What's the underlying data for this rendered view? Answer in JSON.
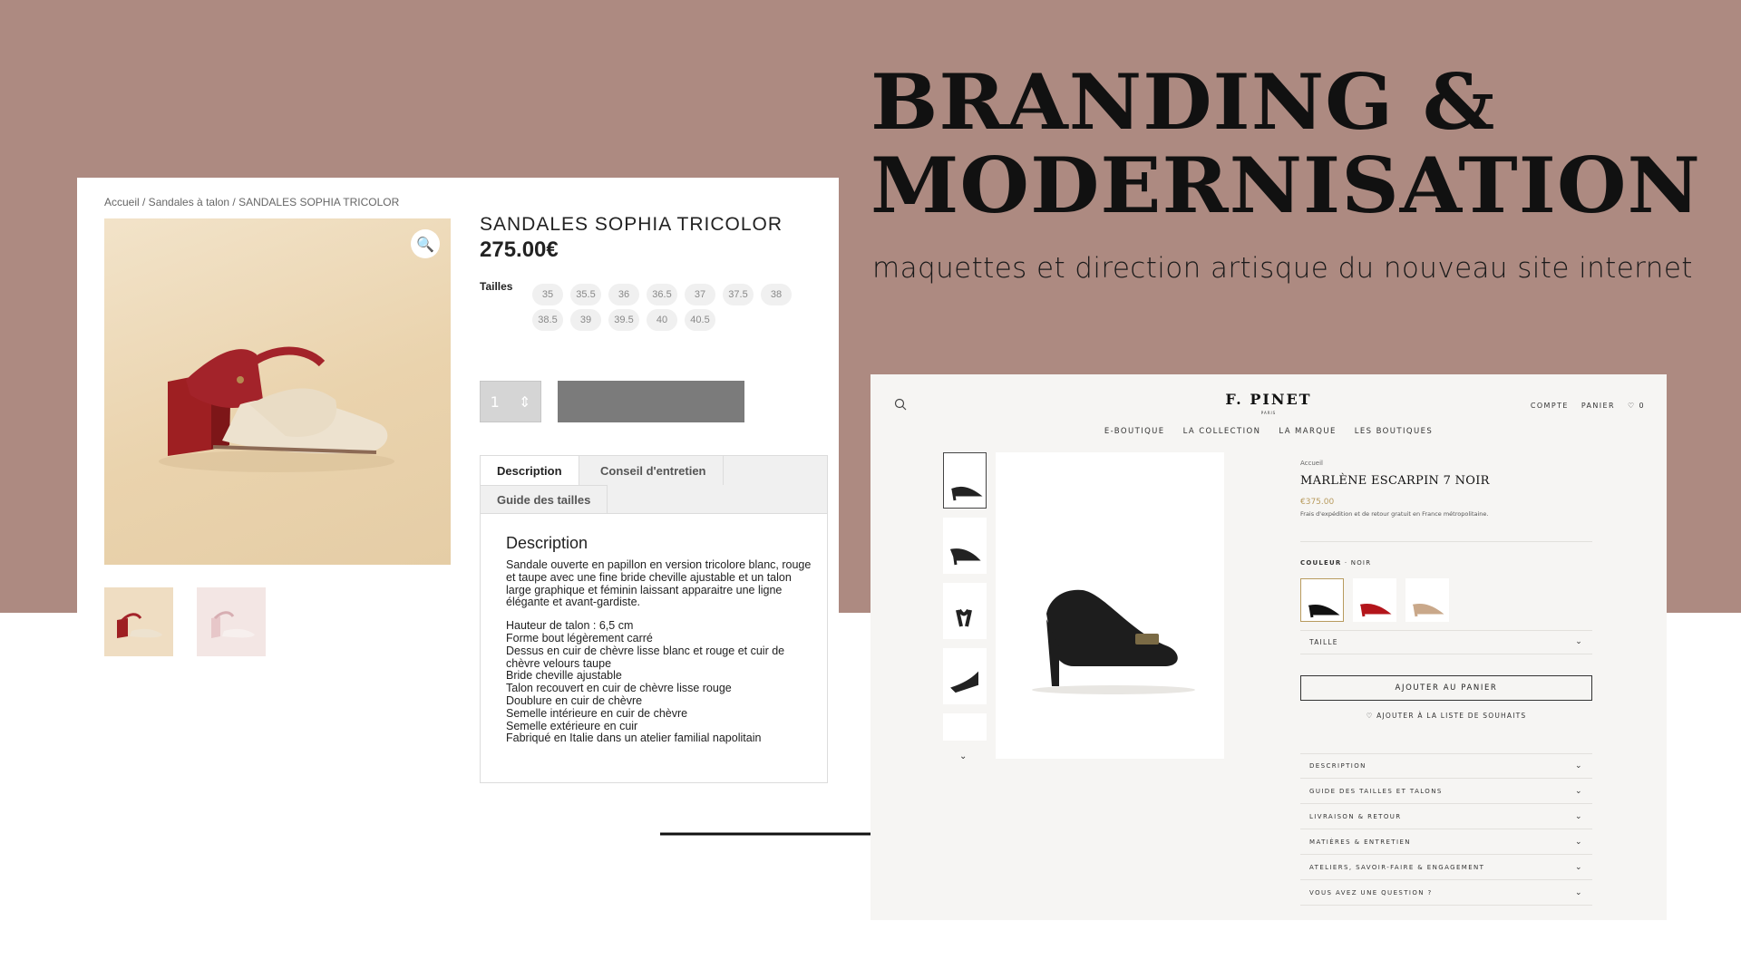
{
  "hero": {
    "title_line1": "BRANDING &",
    "title_line2": "MODERNISATION",
    "subtitle": "maquettes et direction artisque du nouveau site internet"
  },
  "old_site": {
    "breadcrumb": "Accueil / Sandales à talon / SANDALES SOPHIA TRICOLOR",
    "product_name": "SANDALES SOPHIA TRICOLOR",
    "price": "275.00€",
    "sizes_label": "Tailles",
    "sizes": [
      "35",
      "35.5",
      "36",
      "36.5",
      "37",
      "37.5",
      "38",
      "38.5",
      "39",
      "39.5",
      "40",
      "40.5"
    ],
    "quantity": "1",
    "tabs": [
      "Description",
      "Conseil d'entretien",
      "Guide des tailles"
    ],
    "description_heading": "Description",
    "description_p1": "Sandale ouverte en papillon en version tricolore blanc, rouge et taupe avec une fine bride cheville ajustable et un talon large graphique et féminin laissant apparaitre une ligne élégante et avant-gardiste.",
    "description_lines": [
      "Hauteur de talon : 6,5 cm",
      "Forme bout légèrement carré",
      "Dessus en cuir de chèvre lisse blanc et rouge et cuir de chèvre velours taupe",
      "Bride cheville ajustable",
      "Talon recouvert en cuir de chèvre lisse rouge",
      "Doublure en cuir de chèvre",
      "Semelle intérieure en cuir de chèvre",
      "Semelle extérieure en cuir",
      "Fabriqué en Italie dans un atelier familial napolitain"
    ]
  },
  "new_site": {
    "logo": "F. PINET",
    "logo_sub": "PARIS",
    "top_links": [
      "COMPTE",
      "PANIER",
      "♡ 0"
    ],
    "nav": [
      "E-BOUTIQUE",
      "LA COLLECTION",
      "LA MARQUE",
      "LES BOUTIQUES"
    ],
    "breadcrumb": "Accueil",
    "product_name": "MARLÈNE ESCARPIN 7 NOIR",
    "price": "€375.00",
    "shipping": "Frais d'expédition et de retour gratuit en France métropolitaine.",
    "color_label": "COULEUR",
    "color_value": "NOIR",
    "size_label": "TAILLE",
    "add_to_cart": "AJOUTER AU PANIER",
    "wishlist": "♡ AJOUTER À LA LISTE DE SOUHAITS",
    "accordions": [
      "DESCRIPTION",
      "GUIDE DES TAILLES ET TALONS",
      "LIVRAISON & RETOUR",
      "MATIÈRES & ENTRETIEN",
      "ATELIERS, SAVOIR-FAIRE & ENGAGEMENT",
      "VOUS AVEZ UNE QUESTION ?"
    ]
  },
  "colors": {
    "background_top": "#ad8a81",
    "price_gold": "#b89b5e",
    "old_button": "#7b7b7b"
  }
}
